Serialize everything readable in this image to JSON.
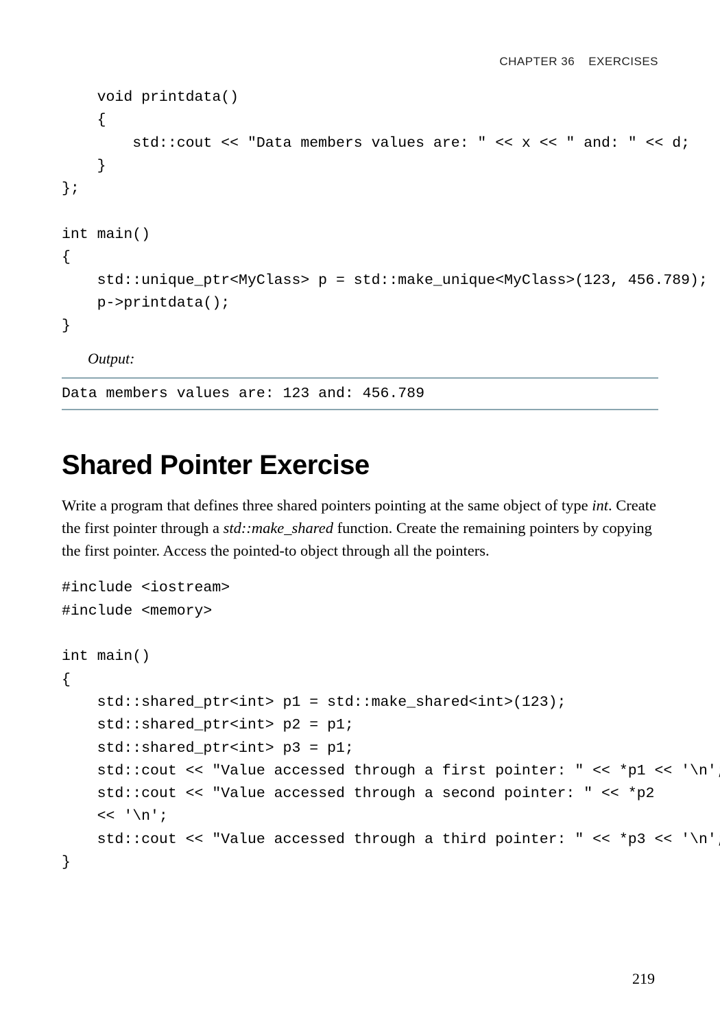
{
  "header": {
    "chapter": "CHAPTER 36",
    "title": "EXERCISES"
  },
  "code1": "    void printdata()\n    {\n        std::cout << \"Data members values are: \" << x << \" and: \" << d;\n    }\n};\n\nint main()\n{\n    std::unique_ptr<MyClass> p = std::make_unique<MyClass>(123, 456.789);\n    p->printdata();\n}",
  "output_label": "Output:",
  "output_text": "Data members values are: 123 and: 456.789",
  "section_heading": "Shared Pointer Exercise",
  "para_parts": {
    "a": "Write a program that defines three shared pointers pointing at the same object of type ",
    "b": "int",
    "c": ". Create the first pointer through a ",
    "d": "std::make_shared",
    "e": " function. Create the remaining pointers by copying the first pointer. Access the pointed-to object through all the pointers."
  },
  "code2": "#include <iostream>\n#include <memory>\n\nint main()\n{\n    std::shared_ptr<int> p1 = std::make_shared<int>(123);\n    std::shared_ptr<int> p2 = p1;\n    std::shared_ptr<int> p3 = p1;\n    std::cout << \"Value accessed through a first pointer: \" << *p1 << '\\n';\n    std::cout << \"Value accessed through a second pointer: \" << *p2 \n    << '\\n';\n    std::cout << \"Value accessed through a third pointer: \" << *p3 << '\\n';\n}",
  "page_number": "219"
}
